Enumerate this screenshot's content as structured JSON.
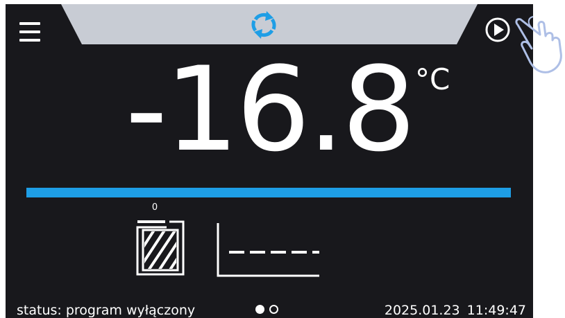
{
  "header": {
    "menu_icon": "hamburger-menu-icon",
    "mode_icon": "sync-icon",
    "start_icon": "play-icon"
  },
  "temperature": {
    "value": "-16.8",
    "unit": "°C"
  },
  "progress": {
    "fraction": 1.0,
    "color": "#1e9ee6"
  },
  "counter": {
    "value": "0"
  },
  "icons": {
    "door": "door-closed-icon",
    "graph": "temperature-graph-icon",
    "hand": "tap-hand-icon"
  },
  "footer": {
    "status": "status: program wyłączony",
    "date": "2025.01.23",
    "time": "11:49:47",
    "pages_total": 2,
    "page_active": 1
  },
  "colors": {
    "background": "#18181c",
    "banner": "#c8ccd4",
    "accent": "#1e9ee6",
    "text": "#ffffff"
  }
}
